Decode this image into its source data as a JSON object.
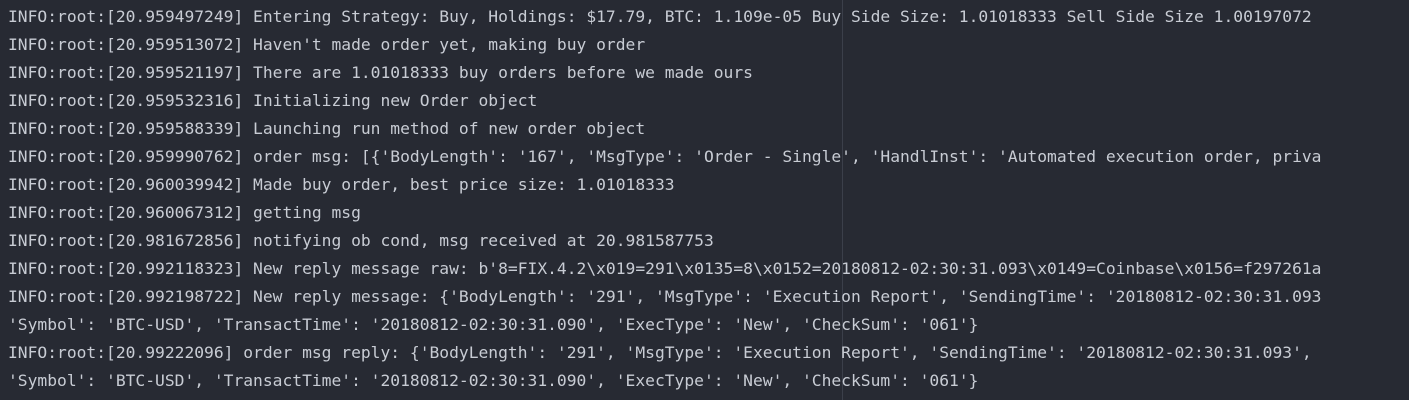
{
  "terminal": {
    "lines": [
      "INFO:root:[20.959497249] Entering Strategy: Buy, Holdings: $17.79, BTC: 1.109e-05 Buy Side Size: 1.01018333 Sell Side Size 1.00197072",
      "INFO:root:[20.959513072] Haven't made order yet, making buy order",
      "INFO:root:[20.959521197] There are 1.01018333 buy orders before we made ours",
      "INFO:root:[20.959532316] Initializing new Order object",
      "INFO:root:[20.959588339] Launching run method of new order object",
      "INFO:root:[20.959990762] order msg: [{'BodyLength': '167', 'MsgType': 'Order - Single', 'HandlInst': 'Automated execution order, priva",
      "INFO:root:[20.960039942] Made buy order, best price size: 1.01018333",
      "INFO:root:[20.960067312] getting msg",
      "INFO:root:[20.981672856] notifying ob cond, msg received at 20.981587753",
      "INFO:root:[20.992118323] New reply message raw: b'8=FIX.4.2\\x019=291\\x0135=8\\x0152=20180812-02:30:31.093\\x0149=Coinbase\\x0156=f297261a",
      "INFO:root:[20.992198722] New reply message: {'BodyLength': '291', 'MsgType': 'Execution Report', 'SendingTime': '20180812-02:30:31.093",
      "'Symbol': 'BTC-USD', 'TransactTime': '20180812-02:30:31.090', 'ExecType': 'New', 'CheckSum': '061'}",
      "INFO:root:[20.99222096] order msg reply: {'BodyLength': '291', 'MsgType': 'Execution Report', 'SendingTime': '20180812-02:30:31.093',",
      "'Symbol': 'BTC-USD', 'TransactTime': '20180812-02:30:31.090', 'ExecType': 'New', 'CheckSum': '061'}"
    ]
  }
}
